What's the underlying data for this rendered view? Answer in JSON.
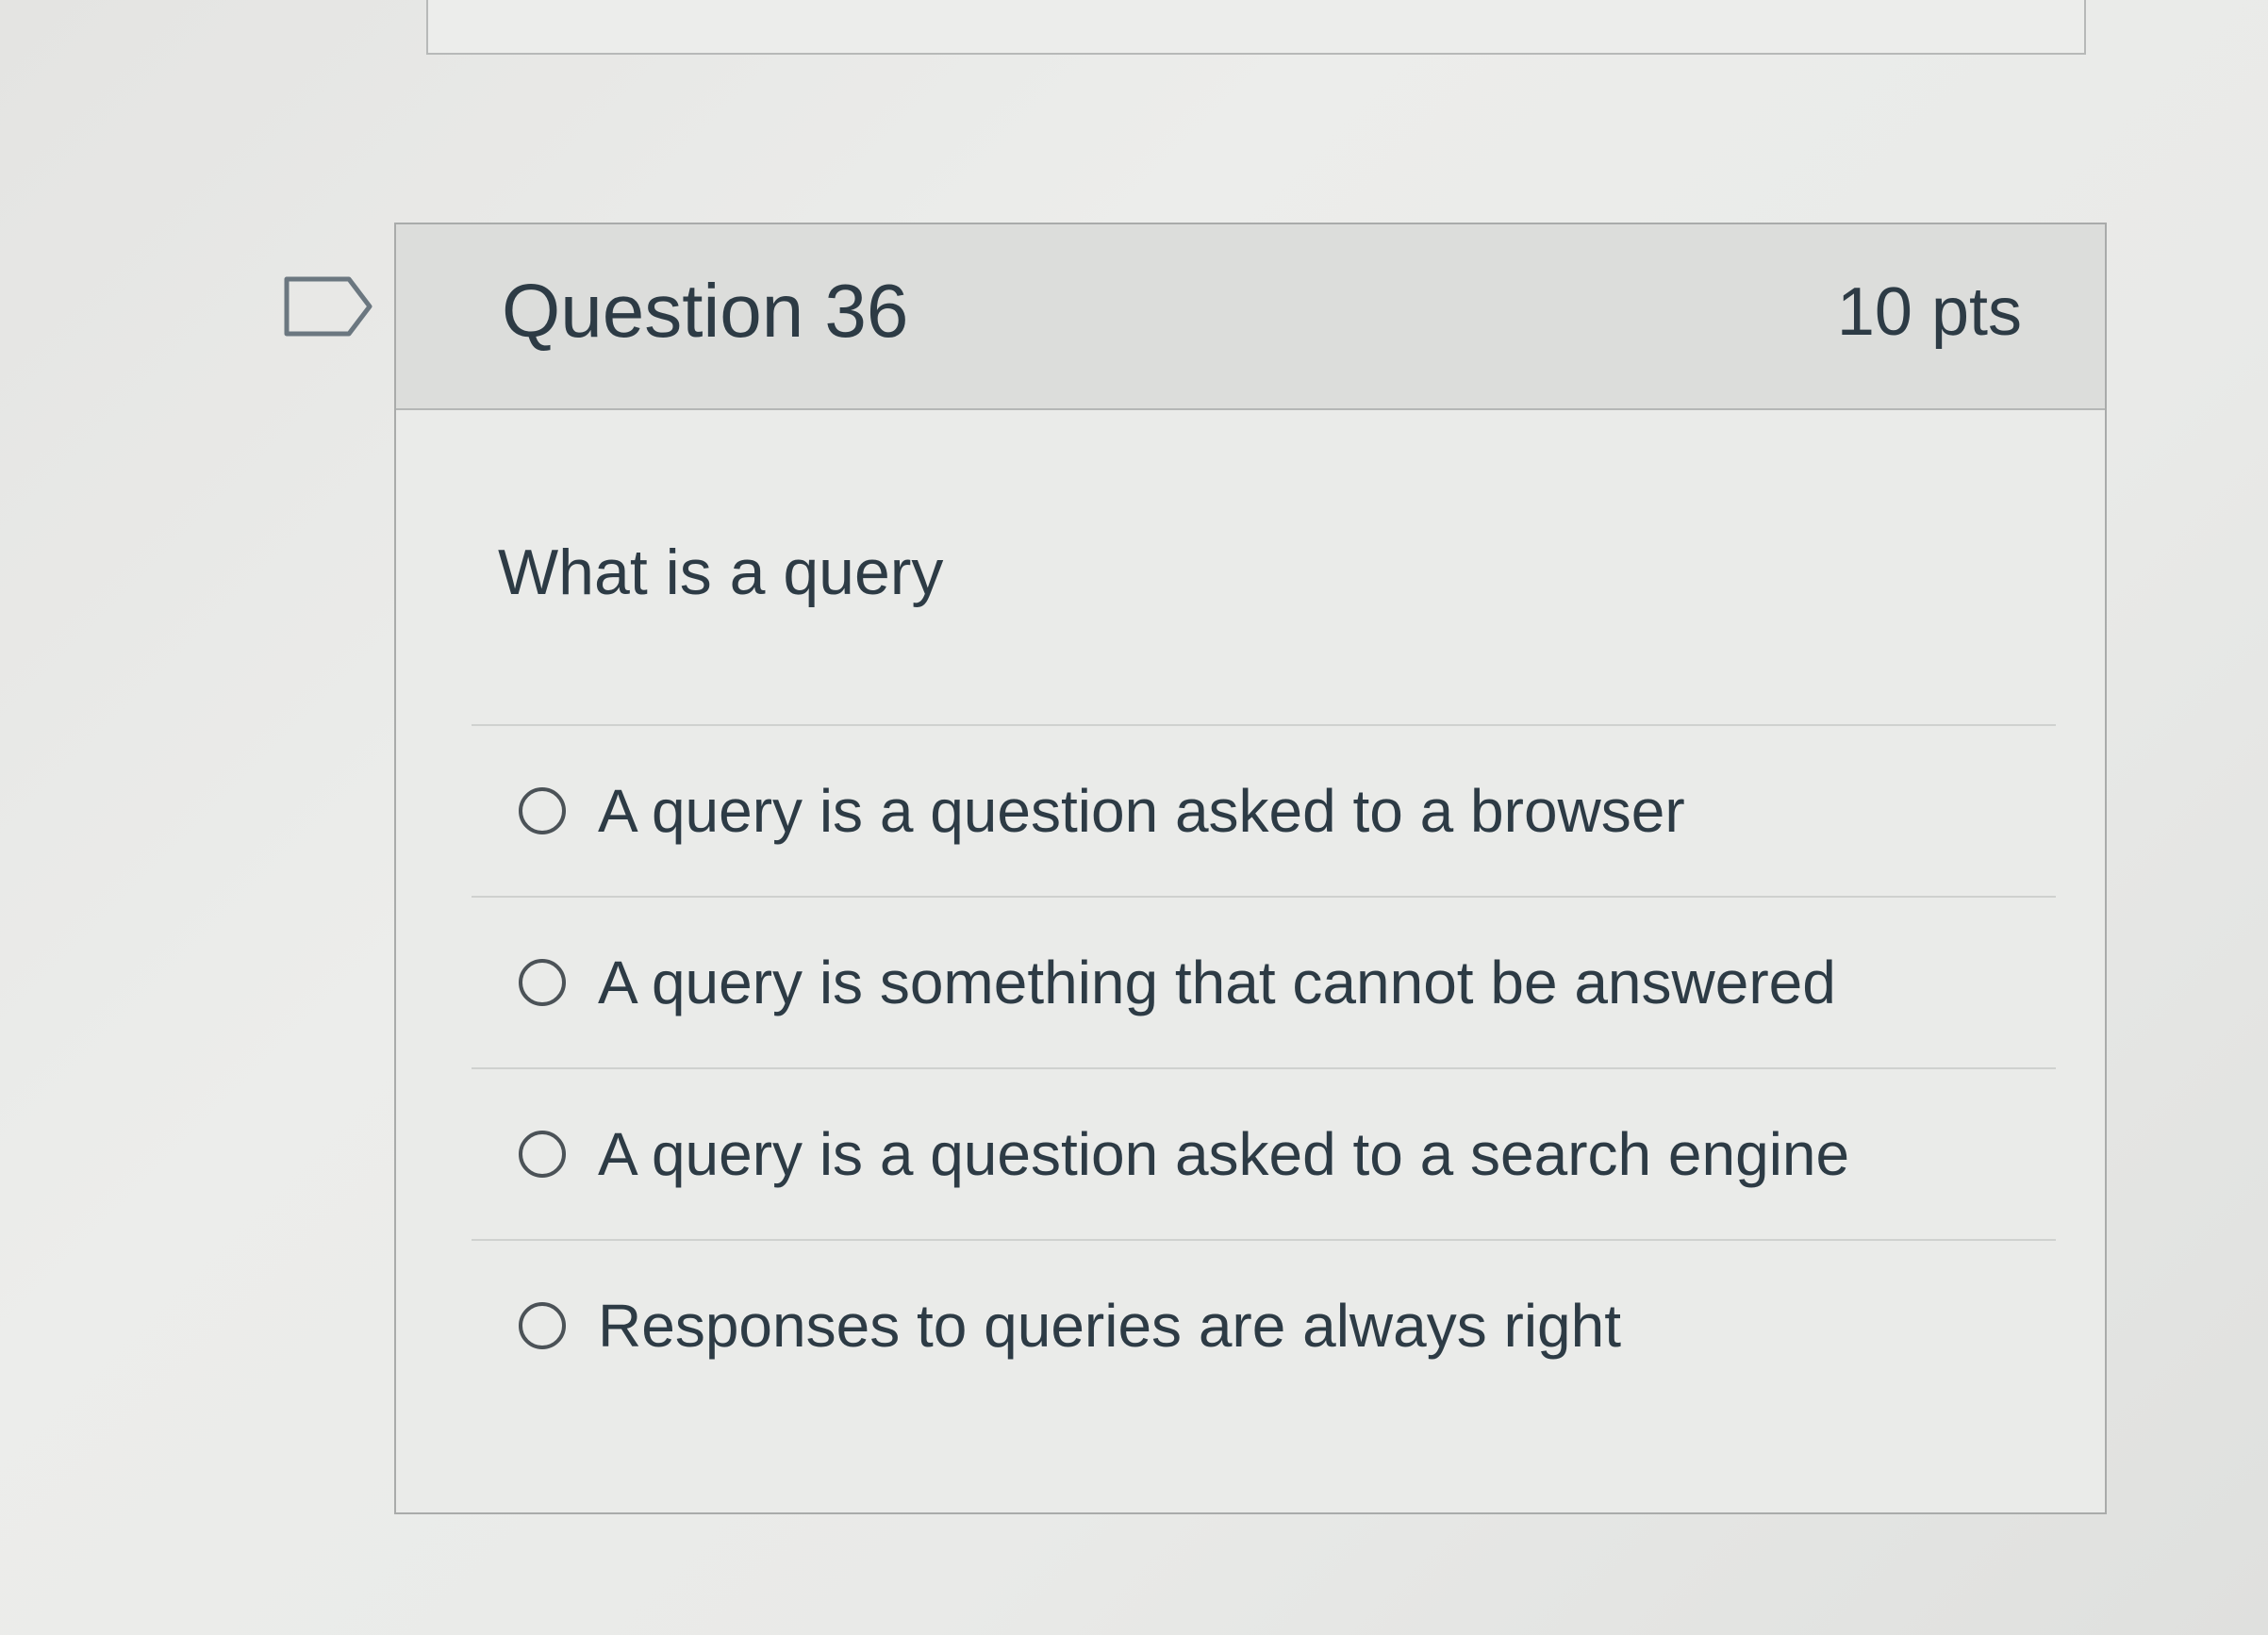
{
  "question": {
    "title": "Question 36",
    "points": "10 pts",
    "text": "What is a query",
    "flag_icon": "flag-outline-icon",
    "answers": [
      {
        "label": "A query is a question asked to a browser",
        "selected": false
      },
      {
        "label": "A query is something that cannot be answered",
        "selected": false
      },
      {
        "label": "A query is a question asked to a search engine",
        "selected": false
      },
      {
        "label": "Responses to queries are always right",
        "selected": false
      }
    ]
  }
}
